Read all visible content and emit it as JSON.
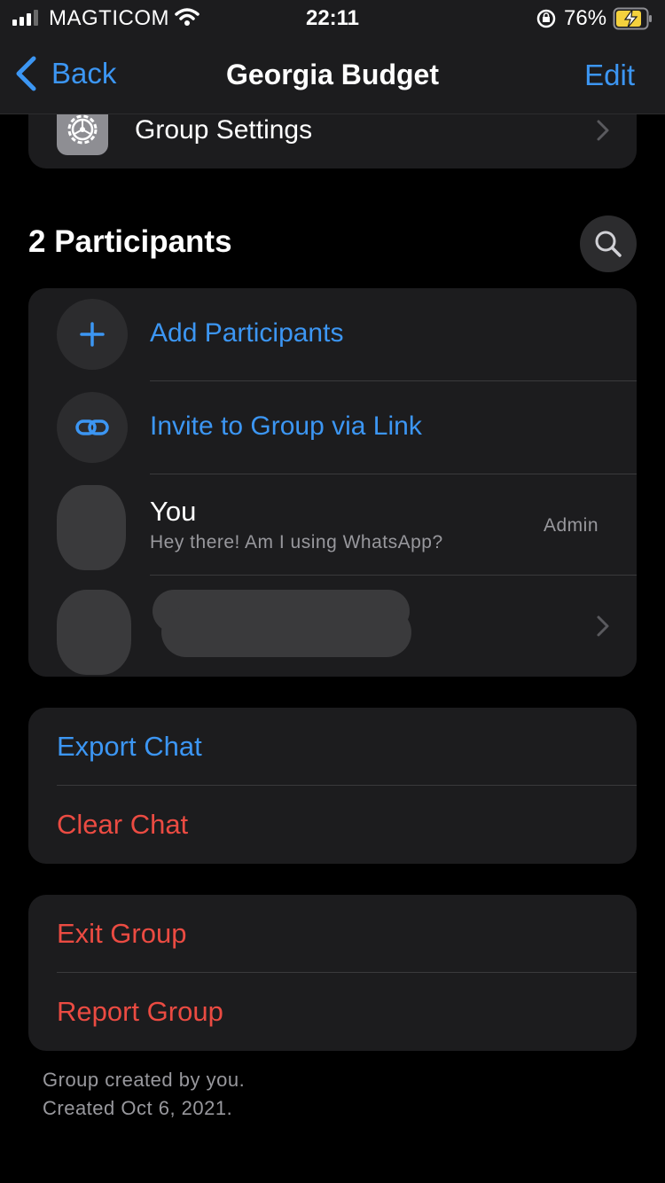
{
  "status_bar": {
    "carrier": "MAGTICOM",
    "time": "22:11",
    "battery_percent": "76%"
  },
  "nav": {
    "back_label": "Back",
    "title": "Georgia Budget",
    "edit_label": "Edit"
  },
  "settings": {
    "label": "Group Settings"
  },
  "participants": {
    "title": "2 Participants",
    "add_label": "Add Participants",
    "invite_label": "Invite to Group via Link",
    "you": {
      "name": "You",
      "status": "Hey there! Am I using WhatsApp?",
      "role": "Admin"
    }
  },
  "chat_actions": {
    "export_label": "Export Chat",
    "clear_label": "Clear Chat"
  },
  "group_actions": {
    "exit_label": "Exit Group",
    "report_label": "Report Group"
  },
  "footer": {
    "created_by": "Group created by you.",
    "created_on": "Created Oct 6, 2021."
  },
  "colors": {
    "accent": "#3c96f3",
    "destructive": "#eb4b42",
    "card": "#1c1c1e",
    "background": "#000000"
  },
  "icons": [
    "signal-icon",
    "wifi-icon",
    "orientation-lock-icon",
    "battery-icon",
    "chevron-left-icon",
    "gear-icon",
    "chevron-right-icon",
    "search-icon",
    "plus-icon",
    "link-icon"
  ]
}
